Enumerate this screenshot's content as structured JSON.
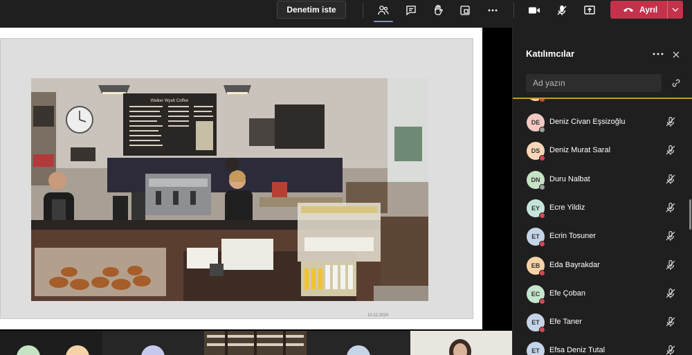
{
  "toolbar": {
    "take_control_label": "Denetim iste",
    "leave_label": "Ayrıl",
    "buttons": [
      {
        "name": "participants-icon",
        "active": true
      },
      {
        "name": "chat-icon"
      },
      {
        "name": "raise-hand-icon"
      },
      {
        "name": "breakout-rooms-icon"
      },
      {
        "name": "more-options-icon"
      },
      {
        "name": "camera-icon"
      },
      {
        "name": "mic-muted-icon"
      },
      {
        "name": "share-screen-icon"
      }
    ]
  },
  "panel": {
    "title": "Katılımcılar",
    "search_placeholder": "Ad yazın"
  },
  "participants": [
    {
      "initials": "DE",
      "name": "Deniz Civan Eşsizoğlu",
      "color": "#f4c9c3",
      "badge": "#9e9e9e"
    },
    {
      "initials": "DS",
      "name": "Deniz Murat Saral",
      "color": "#f7d7b8",
      "badge": "#d74654"
    },
    {
      "initials": "DN",
      "name": "Duru Nalbat",
      "color": "#c7e3c5",
      "badge": "#9e9e9e"
    },
    {
      "initials": "EY",
      "name": "Ecre Yildiz",
      "color": "#c4e5da",
      "badge": "#d74654"
    },
    {
      "initials": "ET",
      "name": "Ecrin Tosuner",
      "color": "#c6d4e8",
      "badge": "#d74654"
    },
    {
      "initials": "EB",
      "name": "Eda Bayrakdar",
      "color": "#f6d3a6",
      "badge": "#d74654"
    },
    {
      "initials": "EC",
      "name": "Efe Çoban",
      "color": "#c5e6cc",
      "badge": "#d74654"
    },
    {
      "initials": "ET",
      "name": "Efe Taner",
      "color": "#c6d4e8",
      "badge": "#d74654"
    },
    {
      "initials": "ET",
      "name": "Efsa Deniz Tutal",
      "color": "#c6d4e8",
      "badge": "#d74654"
    }
  ],
  "slide": {
    "date": "10.12.2020",
    "menu_board_title": "Walker Wyatt Coffee"
  },
  "colors": {
    "accent": "#7f85f5",
    "leave": "#c4314b",
    "list_top_border": "#c99634"
  }
}
